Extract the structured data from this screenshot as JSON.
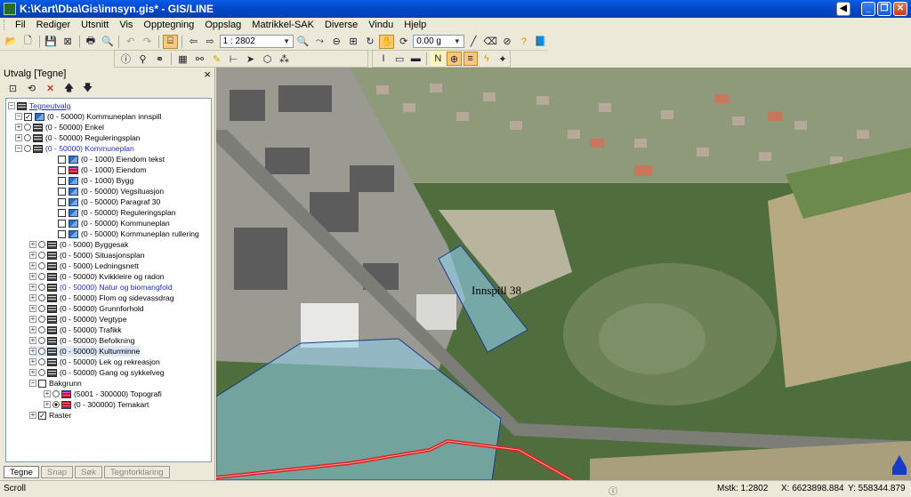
{
  "window": {
    "title": "K:\\Kart\\Dba\\Gis\\innsyn.gis* - GIS/LINE"
  },
  "menu": [
    "Fil",
    "Rediger",
    "Utsnitt",
    "Vis",
    "Opptegning",
    "Oppslag",
    "Matrikkel-SAK",
    "Diverse",
    "Vindu",
    "Hjelp"
  ],
  "toolbar": {
    "scale_value": "1 : 2802",
    "offset_value": "0.00 g"
  },
  "panel": {
    "title": "Utvalg [Tegne]",
    "close": "×",
    "tree": [
      {
        "label": "Tegneutvalg",
        "color": "#1a40c8"
      },
      {
        "label": "(0 - 50000) Kommuneplan innspill"
      },
      {
        "label": "(0 - 50000) Enkel"
      },
      {
        "label": "(0 - 50000) Reguleringsplan"
      },
      {
        "label": "(0 - 50000) Kommuneplan",
        "color": "#2030c8"
      },
      {
        "label": "(0 - 1000) Eiendom tekst"
      },
      {
        "label": "(0 - 1000) Eiendom"
      },
      {
        "label": "(0 - 1000) Bygg"
      },
      {
        "label": "(0 - 50000) Vegsituasjon"
      },
      {
        "label": "(0 - 50000) Paragraf 30"
      },
      {
        "label": "(0 - 50000) Reguleringsplan"
      },
      {
        "label": "(0 - 50000) Kommuneplan"
      },
      {
        "label": "(0 - 50000) Kommuneplan rullering"
      },
      {
        "label": "(0 - 5000) Byggesak"
      },
      {
        "label": "(0 - 5000) Situasjonsplan"
      },
      {
        "label": "(0 - 5000) Ledningsnett"
      },
      {
        "label": "(0 - 50000) Kvikkleire og radon"
      },
      {
        "label": "(0 - 50000) Natur og biomangfold",
        "color": "#2030c8"
      },
      {
        "label": "(0 - 50000) Flom og sidevassdrag"
      },
      {
        "label": "(0 - 50000) Grunnforhold"
      },
      {
        "label": "(0 - 50000) Vegtype"
      },
      {
        "label": "(0 - 50000) Trafikk"
      },
      {
        "label": "(0 - 50000) Befolkning"
      },
      {
        "label": "(0 - 50000) Kulturminne"
      },
      {
        "label": "(0 - 50000) Lek og rekreasjon"
      },
      {
        "label": "(0 - 50000) Gang og sykkelveg"
      },
      {
        "label": "Bakgrunn"
      },
      {
        "label": "(5001 - 300000) Topografi"
      },
      {
        "label": "(0 - 300000) Temakart"
      },
      {
        "label": "Raster"
      }
    ],
    "tabs": [
      "Tegne",
      "Snap",
      "Søk",
      "Tegnforklaring"
    ]
  },
  "map": {
    "label": "Innspill 38"
  },
  "status": {
    "mode": "Scroll",
    "scale": "Mstk: 1:2802",
    "x": "X: 6623898.884",
    "y": "Y: 558344.879"
  }
}
